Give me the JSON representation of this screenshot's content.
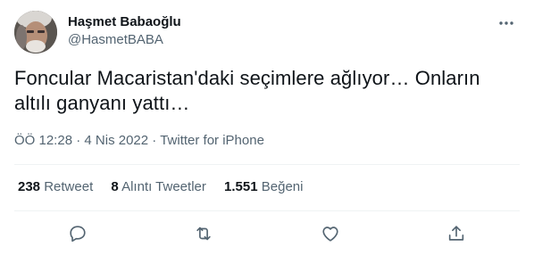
{
  "user": {
    "display_name": "Haşmet Babaoğlu",
    "handle": "@HasmetBABA"
  },
  "tweet": {
    "text_line1": "Foncular Macaristan'daki seçimlere ağlıyor… Onların",
    "text_line2": "altılı ganyanı yattı…"
  },
  "meta": {
    "time": "ÖÖ 12:28",
    "separator": "·",
    "date": "4 Nis 2022",
    "source": "Twitter for iPhone"
  },
  "stats": {
    "retweets_count": "238",
    "retweets_label": "Retweet",
    "quotes_count": "8",
    "quotes_label": "Alıntı Tweetler",
    "likes_count": "1.551",
    "likes_label": "Beğeni"
  },
  "icons": {
    "more": "more-horizontal-icon",
    "reply": "reply-icon",
    "retweet": "retweet-icon",
    "like": "heart-icon",
    "share": "share-icon"
  },
  "colors": {
    "text_primary": "#0f1419",
    "text_secondary": "#536471",
    "divider": "#eff3f4"
  }
}
